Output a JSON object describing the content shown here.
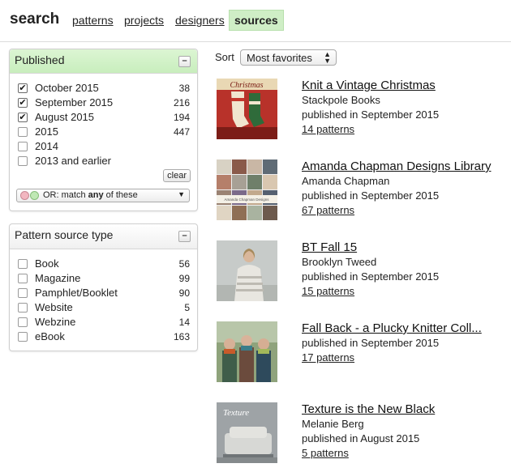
{
  "nav": {
    "brand": "search",
    "links": [
      "patterns",
      "projects",
      "designers",
      "sources"
    ]
  },
  "published": {
    "title": "Published",
    "collapse": "–",
    "options": [
      {
        "label": "October 2015",
        "count": "38",
        "checked": true
      },
      {
        "label": "September 2015",
        "count": "216",
        "checked": true
      },
      {
        "label": "August 2015",
        "count": "194",
        "checked": true
      },
      {
        "label": "2015",
        "count": "447",
        "checked": false
      },
      {
        "label": "2014",
        "count": "",
        "checked": false
      },
      {
        "label": "2013 and earlier",
        "count": "",
        "checked": false
      }
    ],
    "clear": "clear",
    "match": {
      "prefix": "OR: match ",
      "emphasis": "any",
      "suffix": " of these"
    }
  },
  "source_type": {
    "title": "Pattern source type",
    "collapse": "–",
    "options": [
      {
        "label": "Book",
        "count": "56",
        "checked": false
      },
      {
        "label": "Magazine",
        "count": "99",
        "checked": false
      },
      {
        "label": "Pamphlet/Booklet",
        "count": "90",
        "checked": false
      },
      {
        "label": "Website",
        "count": "5",
        "checked": false
      },
      {
        "label": "Webzine",
        "count": "14",
        "checked": false
      },
      {
        "label": "eBook",
        "count": "163",
        "checked": false
      }
    ]
  },
  "sort": {
    "label": "Sort",
    "value": "Most favorites"
  },
  "results": [
    {
      "title": "Knit a Vintage Christmas",
      "by": "Stackpole Books",
      "published": "published in September 2015",
      "patterns": "14 patterns",
      "thumb": "christmas"
    },
    {
      "title": "Amanda Chapman Designs Library",
      "by": "Amanda Chapman",
      "published": "published in September 2015",
      "patterns": "67 patterns",
      "thumb": "grid"
    },
    {
      "title": "BT Fall 15",
      "by": "Brooklyn Tweed",
      "published": "published in September 2015",
      "patterns": "15 patterns",
      "thumb": "sweater"
    },
    {
      "title": "Fall Back - a Plucky Knitter Coll...",
      "by": "",
      "published": "published in September 2015",
      "patterns": "17 patterns",
      "thumb": "group"
    },
    {
      "title": "Texture is the New Black",
      "by": "Melanie Berg",
      "published": "published in August 2015",
      "patterns": "5 patterns",
      "thumb": "texture"
    }
  ],
  "thumb_text": {
    "christmas": "Christmas",
    "grid": "Amanda Chapman Designs",
    "texture": "Texture"
  }
}
